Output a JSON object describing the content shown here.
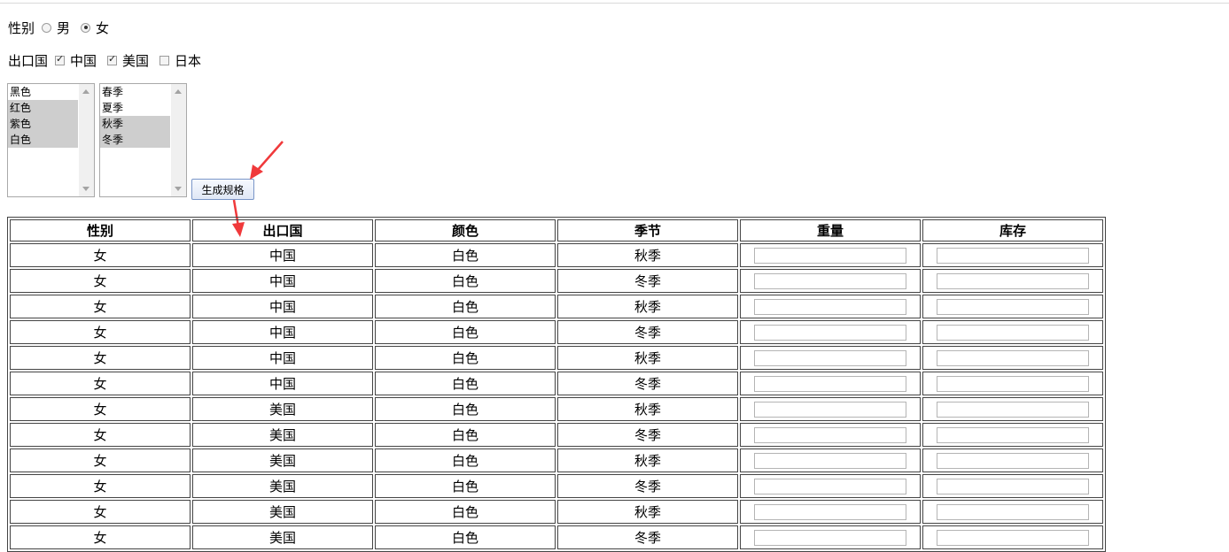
{
  "form": {
    "gender_label": "性别",
    "gender_options": [
      {
        "label": "男",
        "checked": false
      },
      {
        "label": "女",
        "checked": true
      }
    ],
    "country_label": "出口国",
    "country_options": [
      {
        "label": "中国",
        "checked": true
      },
      {
        "label": "美国",
        "checked": true
      },
      {
        "label": "日本",
        "checked": false
      }
    ]
  },
  "colors_list": [
    {
      "label": "黑色",
      "selected": false
    },
    {
      "label": "红色",
      "selected": true
    },
    {
      "label": "紫色",
      "selected": true
    },
    {
      "label": "白色",
      "selected": true
    }
  ],
  "seasons_list": [
    {
      "label": "春季",
      "selected": false
    },
    {
      "label": "夏季",
      "selected": false
    },
    {
      "label": "秋季",
      "selected": true
    },
    {
      "label": "冬季",
      "selected": true
    }
  ],
  "generate_button": "生成规格",
  "table": {
    "headers": [
      "性别",
      "出口国",
      "颜色",
      "季节",
      "重量",
      "库存"
    ],
    "rows": [
      [
        "女",
        "中国",
        "白色",
        "秋季",
        "",
        ""
      ],
      [
        "女",
        "中国",
        "白色",
        "冬季",
        "",
        ""
      ],
      [
        "女",
        "中国",
        "白色",
        "秋季",
        "",
        ""
      ],
      [
        "女",
        "中国",
        "白色",
        "冬季",
        "",
        ""
      ],
      [
        "女",
        "中国",
        "白色",
        "秋季",
        "",
        ""
      ],
      [
        "女",
        "中国",
        "白色",
        "冬季",
        "",
        ""
      ],
      [
        "女",
        "美国",
        "白色",
        "秋季",
        "",
        ""
      ],
      [
        "女",
        "美国",
        "白色",
        "冬季",
        "",
        ""
      ],
      [
        "女",
        "美国",
        "白色",
        "秋季",
        "",
        ""
      ],
      [
        "女",
        "美国",
        "白色",
        "冬季",
        "",
        ""
      ],
      [
        "女",
        "美国",
        "白色",
        "秋季",
        "",
        ""
      ],
      [
        "女",
        "美国",
        "白色",
        "冬季",
        "",
        ""
      ]
    ]
  },
  "annotation_color": "#f0393b"
}
